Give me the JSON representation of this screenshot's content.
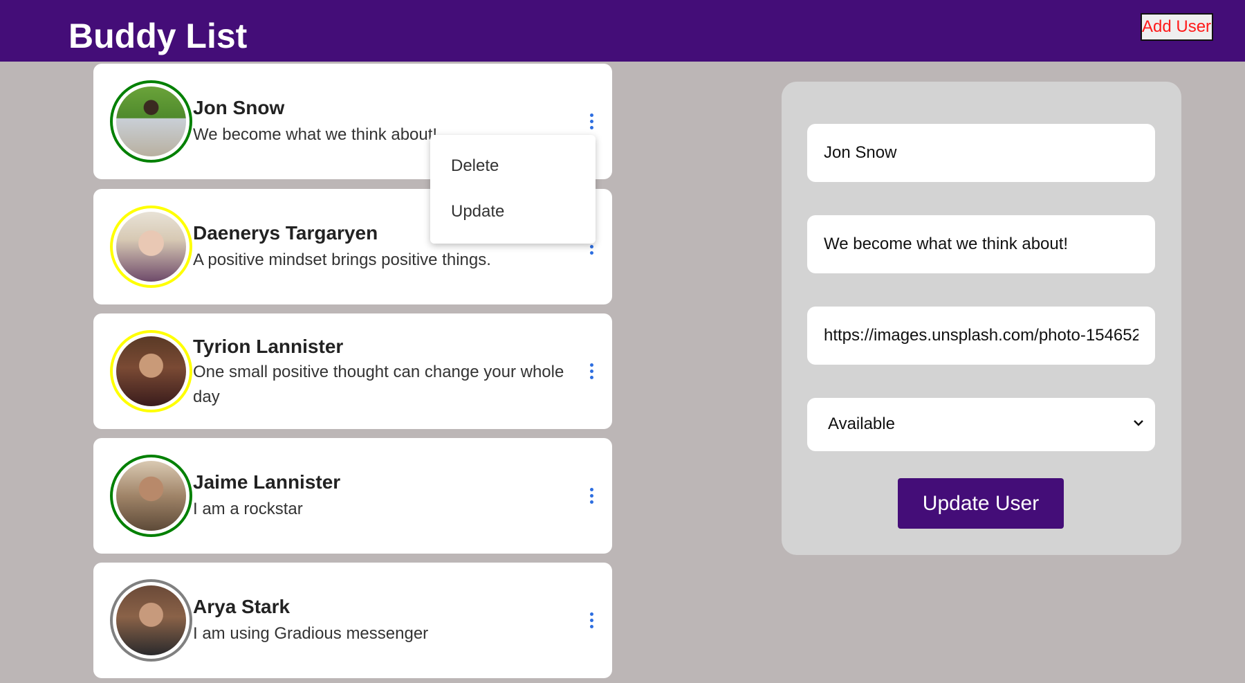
{
  "header": {
    "title": "Buddy List",
    "add_user_label": "Add User",
    "background_color": "#440d78"
  },
  "buddies": [
    {
      "name": "Jon Snow",
      "status": "We become what we think about!",
      "availability_color": "green"
    },
    {
      "name": "Daenerys Targaryen",
      "status": "A positive mindset brings positive things.",
      "availability_color": "yellow"
    },
    {
      "name": "Tyrion Lannister",
      "status": "One small positive thought can change your whole day",
      "availability_color": "yellow"
    },
    {
      "name": "Jaime Lannister",
      "status": "I am a rockstar",
      "availability_color": "green"
    },
    {
      "name": "Arya Stark",
      "status": "I am using Gradious messenger",
      "availability_color": "gray"
    }
  ],
  "context_menu": {
    "items": [
      "Delete",
      "Update"
    ]
  },
  "edit_form": {
    "name_value": "Jon Snow",
    "status_value": "We become what we think about!",
    "image_url_value": "https://images.unsplash.com/photo-154652",
    "availability_selected": "Available",
    "submit_label": "Update User"
  }
}
